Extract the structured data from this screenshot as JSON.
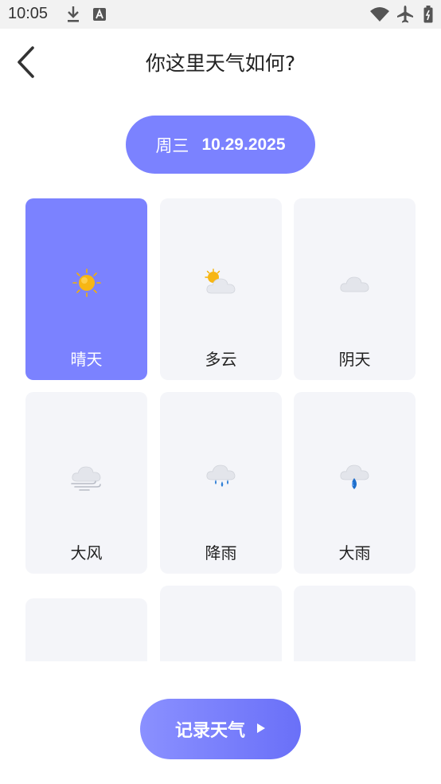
{
  "status_bar": {
    "time": "10:05"
  },
  "header": {
    "title": "你这里天气如何?"
  },
  "date": {
    "weekday": "周三",
    "value": "10.29.2025"
  },
  "weather_options": [
    {
      "label": "晴天",
      "icon": "sunny-icon",
      "selected": true
    },
    {
      "label": "多云",
      "icon": "partly-cloudy-icon",
      "selected": false
    },
    {
      "label": "阴天",
      "icon": "overcast-icon",
      "selected": false
    },
    {
      "label": "大风",
      "icon": "windy-icon",
      "selected": false
    },
    {
      "label": "降雨",
      "icon": "rain-icon",
      "selected": false
    },
    {
      "label": "大雨",
      "icon": "heavy-rain-icon",
      "selected": false
    }
  ],
  "actions": {
    "record_label": "记录天气"
  },
  "colors": {
    "accent": "#7b82ff",
    "card_bg": "#f4f5f9",
    "text": "#222222"
  }
}
